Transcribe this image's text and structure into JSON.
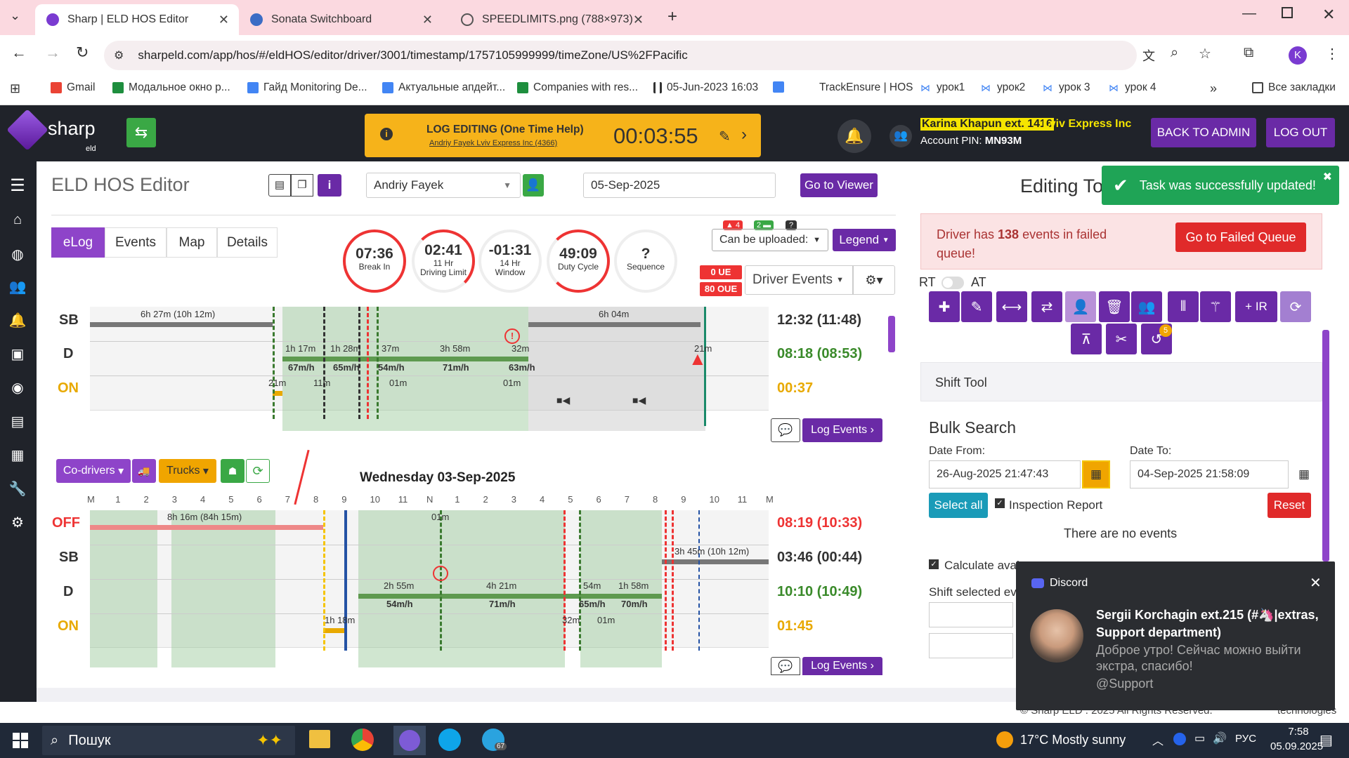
{
  "browser": {
    "tabs": [
      {
        "title": "Sharp | ELD HOS Editor"
      },
      {
        "title": "Sonata Switchboard"
      },
      {
        "title": "SPEEDLIMITS.png (788×973)"
      }
    ],
    "url": "sharpeld.com/app/hos/#/eldHOS/editor/driver/3001/timestamp/1757105999999/timeZone/US%2FPacific",
    "profile_initial": "K",
    "bookmarks": [
      "Gmail",
      "Модальное окно р...",
      "Гайд Monitoring De...",
      "Актуальные апдейт...",
      "Companies with res...",
      "05-Jun-2023 16:03",
      "TrackEnsure | HOS",
      "урок1",
      "урок2",
      "урок 3",
      "урок 4"
    ],
    "all_bookmarks": "Все закладки"
  },
  "header": {
    "logo_text": "sharp",
    "logo_sub": "eld",
    "banner_title": "LOG EDITING (One Time Help)",
    "banner_sub": "Andriy Fayek  Lviv Express Inc (4366)",
    "timer": "00:03:55",
    "user_name": "Karina Khapun ext. 1416",
    "company": "Lviv Express Inc",
    "account_pin_label": "Account PIN:",
    "account_pin": "MN93M",
    "back_to_admin": "BACK TO ADMIN",
    "logout": "LOG OUT"
  },
  "editor": {
    "title": "ELD HOS Editor",
    "driver": "Andriy Fayek",
    "date": "05-Sep-2025",
    "go_to_viewer": "Go to Viewer",
    "tabs": [
      "eLog",
      "Events",
      "Map",
      "Details"
    ],
    "clocks": [
      {
        "value": "07:36",
        "label": "Break In"
      },
      {
        "value": "02:41",
        "label": "11 Hr",
        "label2": "Driving Limit"
      },
      {
        "value": "-01:31",
        "label": "14 Hr",
        "label2": "Window"
      },
      {
        "value": "49:09",
        "label": "Duty Cycle"
      },
      {
        "value": "?",
        "label": "Sequence"
      }
    ],
    "badges": {
      "warn": "4",
      "trucks": "2",
      "q": "?"
    },
    "can_be_uploaded": "Can be uploaded:",
    "legend": "Legend",
    "ue": "0 UE",
    "oue": "80 OUE",
    "driver_events": "Driver Events",
    "co_drivers": "Co-drivers",
    "trucks": "Trucks",
    "log_events": "Log Events"
  },
  "chart1": {
    "rows": [
      "SB",
      "D",
      "ON"
    ],
    "totals": [
      "12:32 (11:48)",
      "08:18 (08:53)",
      "00:37"
    ],
    "labels": [
      "6h 27m (10h 12m)",
      "6h 04m",
      "1h 17m",
      "1h 28m",
      "37m",
      "3h 58m",
      "32m",
      "67m/h",
      "65m/h",
      "54m/h",
      "71m/h",
      "63m/h",
      "21m",
      "11m",
      "01m",
      "01m",
      "21m"
    ]
  },
  "chart2": {
    "title": "Wednesday 03-Sep-2025",
    "hours": [
      "M",
      "1",
      "2",
      "3",
      "4",
      "5",
      "6",
      "7",
      "8",
      "9",
      "10",
      "11",
      "N",
      "1",
      "2",
      "3",
      "4",
      "5",
      "6",
      "7",
      "8",
      "9",
      "10",
      "11",
      "M"
    ],
    "rows": [
      "OFF",
      "SB",
      "D",
      "ON"
    ],
    "totals": [
      "08:19 (10:33)",
      "03:46 (00:44)",
      "10:10 (10:49)",
      "01:45"
    ],
    "labels": [
      "8h 16m (84h 15m)",
      "01m",
      "3h 45m (10h 12m)",
      "2h 55m",
      "4h 21m",
      "54m",
      "1h 58m",
      "54m/h",
      "71m/h",
      "65m/h",
      "70m/h",
      "1h 18m",
      "32m",
      "01m"
    ]
  },
  "right": {
    "editing": "Editing To",
    "toast": "Task was successfully updated!",
    "failed_pre": "Driver has ",
    "failed_count": "138",
    "failed_post": " events in failed queue!",
    "failed_btn": "Go to Failed Queue",
    "rt": "RT",
    "at": "AT",
    "ir_btn": "+ IR",
    "badge5": "5",
    "shift_tool": "Shift Tool",
    "bulk_search": "Bulk Search",
    "date_from_label": "Date From:",
    "date_from": "26-Aug-2025 21:47:43",
    "date_to_label": "Date To:",
    "date_to": "04-Sep-2025 21:58:09",
    "select_all": "Select all",
    "inspection": "Inspection Report",
    "reset": "Reset",
    "no_events": "There are no events",
    "calc": "Calculate avai",
    "shift_selected": "Shift selected eve",
    "footer": "© Sharp ELD . 2025 All Rights Reserved.",
    "footer2": "technologies"
  },
  "discord": {
    "app": "Discord",
    "sender": "Sergii Korchagin ext.215 (#🦄|extras, Support department)",
    "line1": "Доброе утро! Сейчас можно выйти",
    "line2": "экстра, спасибо!",
    "line3": "@Support"
  },
  "taskbar": {
    "search": "Пошук",
    "weather": "17°C  Mostly sunny",
    "lang": "РУС",
    "time": "7:58",
    "date": "05.09.2025",
    "telegram_badge": "67"
  }
}
